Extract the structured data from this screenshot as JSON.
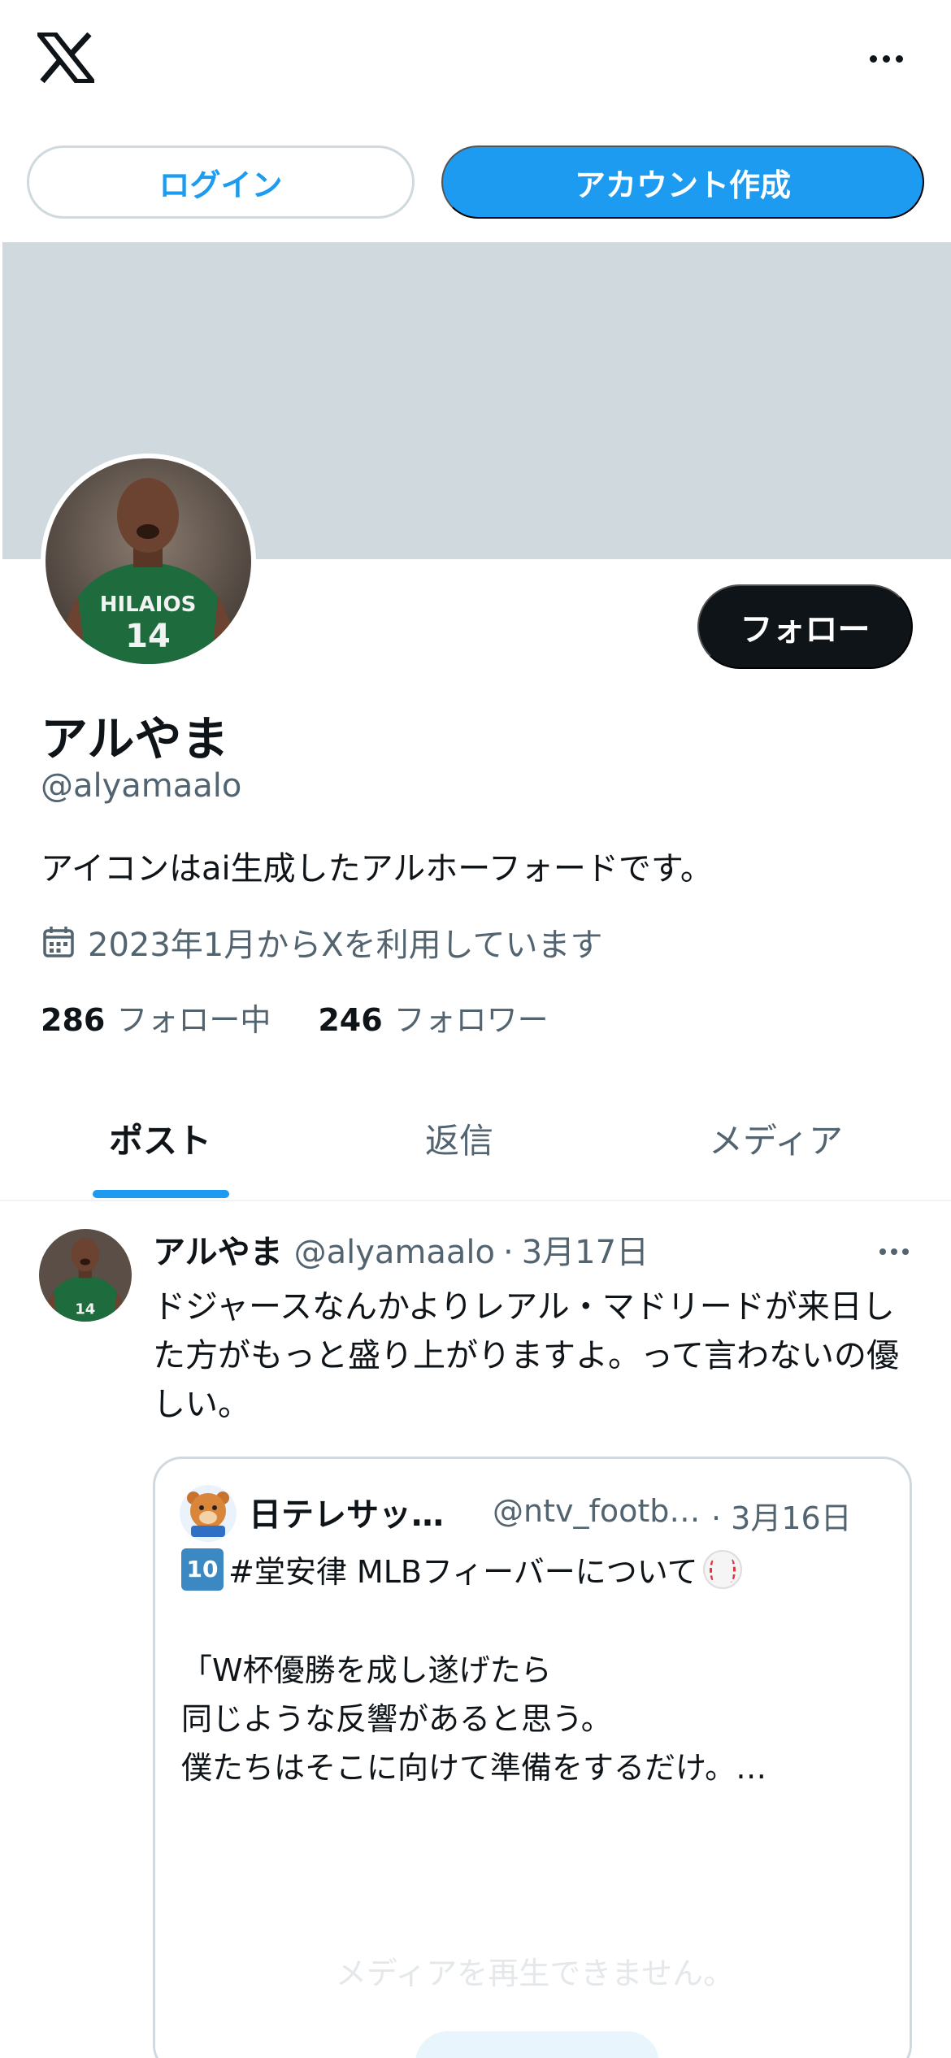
{
  "header": {
    "logo_icon": "x-logo-icon",
    "more_icon": "more-horizontal-icon",
    "login_label": "ログイン",
    "signup_label": "アカウント作成"
  },
  "profile": {
    "display_name": "アルやま",
    "handle": "@alyamaalo",
    "bio": "アイコンはai生成したアルホーフォードです。",
    "joined": "2023年1月からXを利用しています",
    "following_count": "286",
    "following_label": "フォロー中",
    "followers_count": "246",
    "followers_label": "フォロワー",
    "follow_label": "フォロー",
    "banner_color": "#cfd9de"
  },
  "tabs": [
    {
      "label": "ポスト",
      "active": true
    },
    {
      "label": "返信",
      "active": false
    },
    {
      "label": "メディア",
      "active": false
    }
  ],
  "post": {
    "author_name": "アルやま",
    "author_handle": "@alyamaalo",
    "separator": "·",
    "date": "3月17日",
    "text": "ドジャースなんかよりレアル・マドリードが来日した方がもっと盛り上がりますよ。って言わないの優しい。",
    "quote": {
      "author_name": "日テレサッ…",
      "author_handle": "@ntv_footb…",
      "date": "· 3月16日",
      "line1": "#堂安律  MLBフィーバーについて",
      "emoji_ten": "10",
      "line2": "「W杯優勝を成し遂げたら",
      "line3": "同じような反響があると思う。",
      "line4": "僕たちはそこに向けて準備をするだけ。…",
      "media_message": "メディアを再生できません。"
    }
  },
  "colors": {
    "accent": "#1d9bf0",
    "text_primary": "#0f1419",
    "text_secondary": "#536471"
  }
}
